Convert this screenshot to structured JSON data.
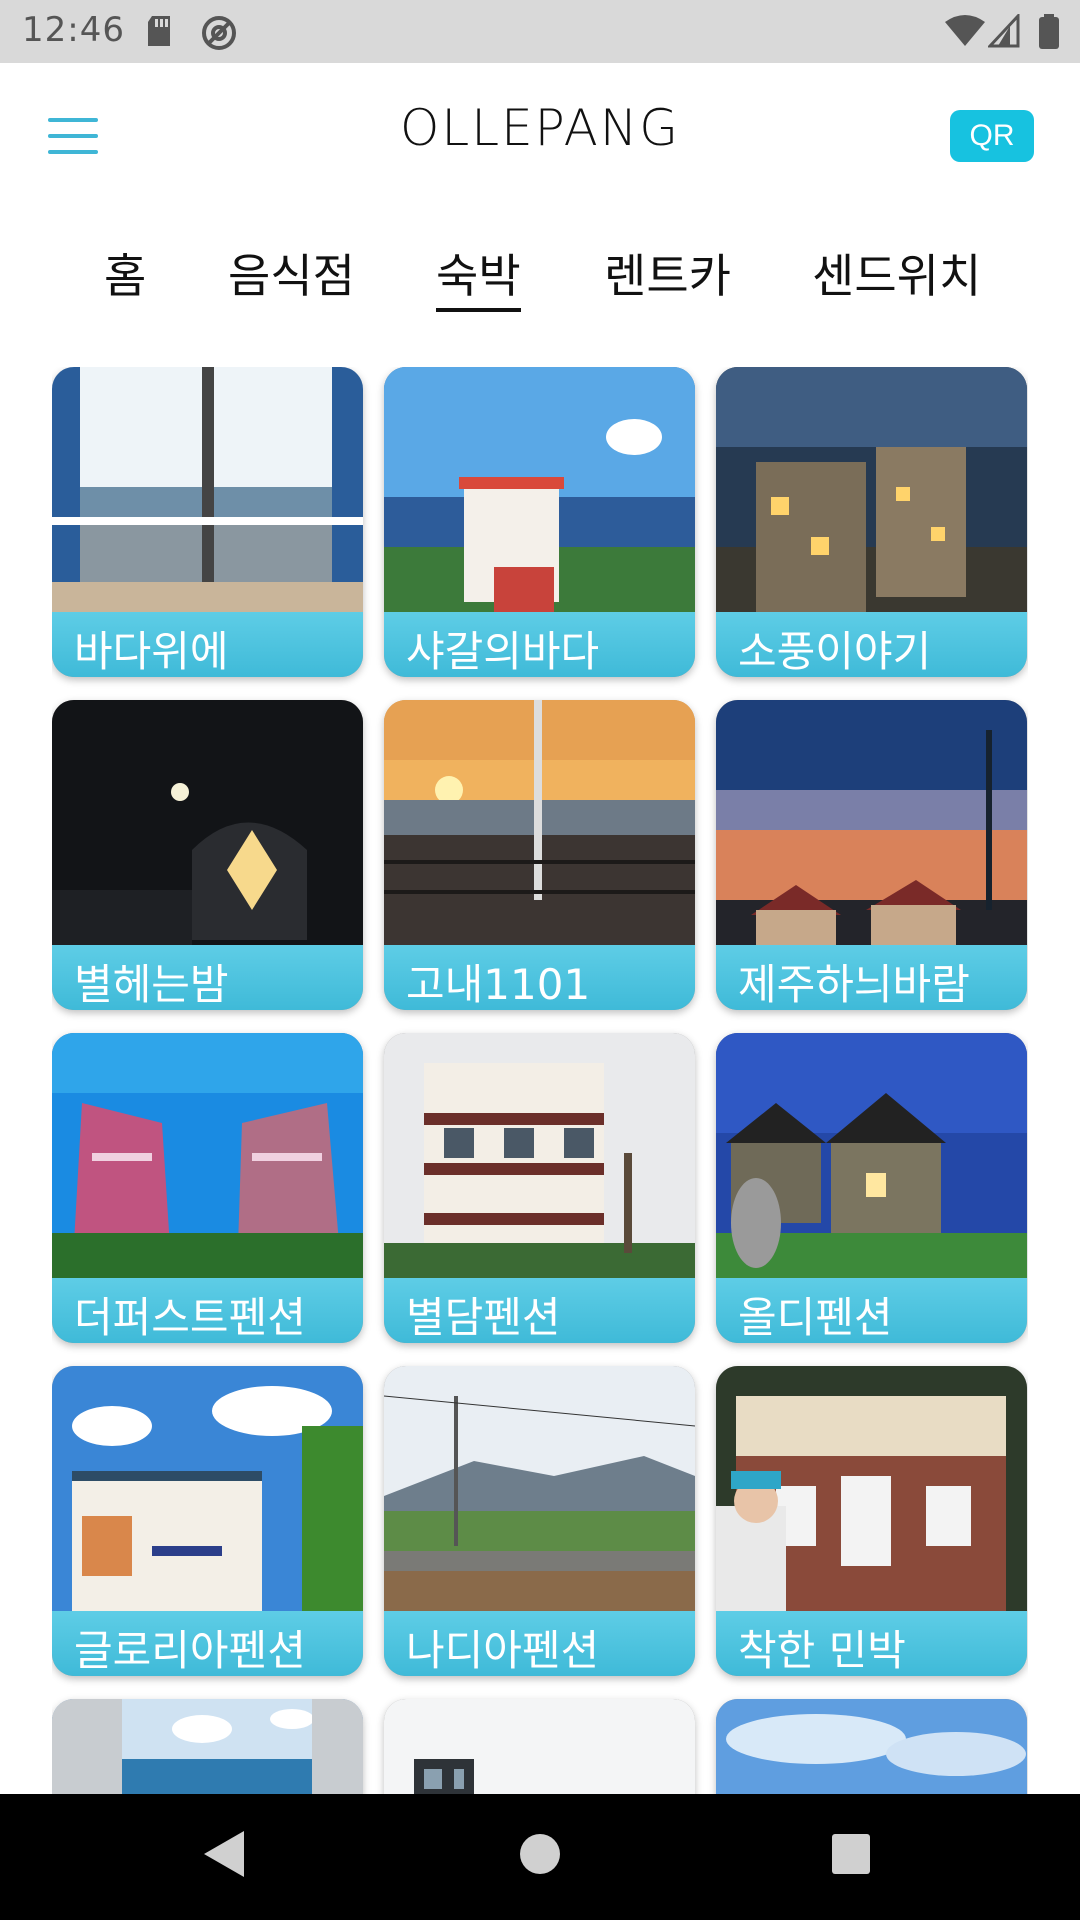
{
  "status_bar": {
    "time": "12:46"
  },
  "header": {
    "title": "OLLEPANG",
    "qr_label": "QR"
  },
  "tabs": [
    {
      "label": "홈",
      "active": false
    },
    {
      "label": "음식점",
      "active": false
    },
    {
      "label": "숙박",
      "active": true
    },
    {
      "label": "렌트카",
      "active": false
    },
    {
      "label": "센드위치",
      "active": false
    }
  ],
  "listings": [
    {
      "name": "바다위에",
      "scene": "ocean-view-window"
    },
    {
      "name": "샤갈의바다",
      "scene": "seaside-building"
    },
    {
      "name": "소풍이야기",
      "scene": "dusk-villas"
    },
    {
      "name": "별헤는밤",
      "scene": "night-dome"
    },
    {
      "name": "고내1101",
      "scene": "sunset-terrace"
    },
    {
      "name": "제주하늬바람",
      "scene": "twilight-houses"
    },
    {
      "name": "더퍼스트펜션",
      "scene": "blue-sky-towers"
    },
    {
      "name": "별담펜션",
      "scene": "balcony-pension"
    },
    {
      "name": "올디펜션",
      "scene": "stone-cottage-night"
    },
    {
      "name": "글로리아펜션",
      "scene": "cloudy-pension"
    },
    {
      "name": "나디아펜션",
      "scene": "mountain-road"
    },
    {
      "name": "착한 민박",
      "scene": "brick-minbak"
    },
    {
      "name": "",
      "scene": "window-sea"
    },
    {
      "name": "",
      "scene": "modern-house"
    },
    {
      "name": "",
      "scene": "sky"
    }
  ],
  "colors": {
    "accent": "#17c2e0",
    "label_bar": "#4cc4df",
    "menu": "#3fb6d6"
  },
  "icons": [
    "menu-icon",
    "sd-card-icon",
    "at-icon",
    "wifi-icon",
    "signal-icon",
    "battery-icon",
    "back-icon",
    "home-icon",
    "recents-icon"
  ]
}
